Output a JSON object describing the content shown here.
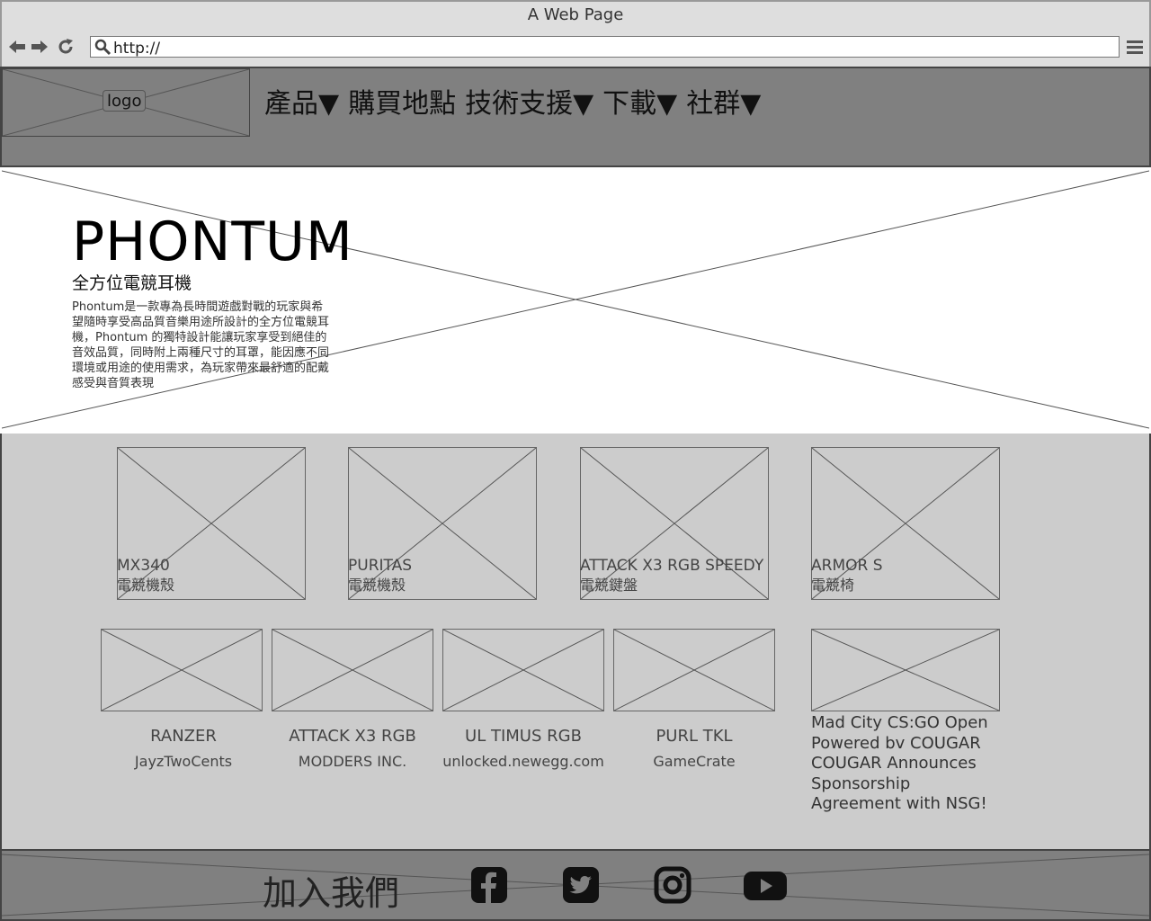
{
  "browser": {
    "title": "A Web Page",
    "url": "http://",
    "back_icon": "arrow-left",
    "forward_icon": "arrow-right",
    "reload_icon": "reload",
    "search_icon": "magnifier",
    "menu_icon": "hamburger"
  },
  "header": {
    "logo_label": "logo",
    "nav": [
      "產品▼",
      "購買地點",
      "技術支援▼",
      "下載▼",
      "社群▼"
    ]
  },
  "hero": {
    "title": "PHONTUM",
    "subtitle": "全方位電競耳機",
    "description": "Phontum是一款專為長時間遊戲對戰的玩家與希望隨時享受高品質音樂用途所設計的全方位電競耳機，Phontum 的獨特設計能讓玩家享受到絕佳的音效品質，同時附上兩種尺寸的耳罩，能因應不同環境或用途的使用需求，為玩家帶來最舒適的配戴感受與音質表現"
  },
  "products": [
    {
      "name": "MX340",
      "category": "電競機殼"
    },
    {
      "name": "PURITAS",
      "category": "電競機殼"
    },
    {
      "name": "ATTACK X3 RGB SPEEDY",
      "category": "電競鍵盤"
    },
    {
      "name": "ARMOR S",
      "category": "電競椅"
    }
  ],
  "reviews": [
    {
      "name": "RANZER",
      "source": "JayzTwoCents"
    },
    {
      "name": "ATTACK X3 RGB",
      "source": "MODDERS INC."
    },
    {
      "name": "UL TIMUS RGB",
      "source": "unlocked.newegg.com"
    },
    {
      "name": "PURL TKL",
      "source": "GameCrate"
    }
  ],
  "news": {
    "text": "Mad City CS:GO Open Powered bv COUGAR COUGAR Announces Sponsorship Agreement with NSG!"
  },
  "footer": {
    "join_label": "加入我們",
    "social_icons": [
      "facebook-icon",
      "twitter-icon",
      "instagram-icon",
      "youtube-icon"
    ]
  }
}
